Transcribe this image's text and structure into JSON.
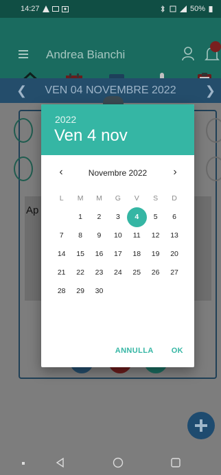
{
  "status_bar": {
    "time": "14:27",
    "battery": "50%"
  },
  "header": {
    "user_name": "Andrea Bianchi",
    "nav_tabs": [
      "home-icon",
      "calendar-icon",
      "chat-icon",
      "thermometer-icon",
      "clipboard-icon"
    ]
  },
  "date_bar": {
    "title": "VEN 04 NOVEMBRE 2022"
  },
  "background": {
    "text": "Ap"
  },
  "dialog": {
    "year": "2022",
    "selected_date": "Ven 4 nov",
    "month_label": "Novembre 2022",
    "weekdays": [
      "L",
      "M",
      "M",
      "G",
      "V",
      "S",
      "D"
    ],
    "weeks": [
      [
        "",
        "1",
        "2",
        "3",
        "4",
        "5",
        "6"
      ],
      [
        "7",
        "8",
        "9",
        "10",
        "11",
        "12",
        "13"
      ],
      [
        "14",
        "15",
        "16",
        "17",
        "18",
        "19",
        "20"
      ],
      [
        "21",
        "22",
        "23",
        "24",
        "25",
        "26",
        "27"
      ],
      [
        "28",
        "29",
        "30",
        "",
        "",
        "",
        ""
      ]
    ],
    "selected_day": "4",
    "cancel_label": "ANNULLA",
    "ok_label": "OK"
  },
  "colors": {
    "accent": "#35b6a4",
    "header": "#1a6b5f",
    "date_bar": "#244d6b"
  }
}
